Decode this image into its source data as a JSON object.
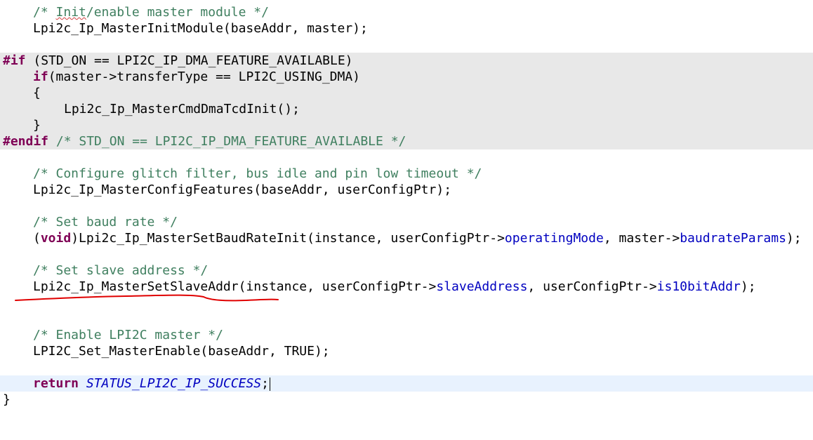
{
  "code": {
    "l1_comment_pre": "/* ",
    "l1_comment_word": "Init",
    "l1_comment_post": "/enable master module */",
    "l2": "Lpi2c_Ip_MasterInitModule(baseAddr, master);",
    "l4_directive": "#if",
    "l4_rest": " (STD_ON == LPI2C_IP_DMA_FEATURE_AVAILABLE)",
    "l5_kw": "if",
    "l5_rest": "(master->transferType == LPI2C_USING_DMA)",
    "l6": "{",
    "l7": "Lpi2c_Ip_MasterCmdDmaTcdInit();",
    "l8": "}",
    "l9_directive": "#endif",
    "l9_comment": " /* STD_ON == LPI2C_IP_DMA_FEATURE_AVAILABLE */",
    "l11_comment": "/* Configure glitch filter, bus idle and pin low timeout */",
    "l12": "Lpi2c_Ip_MasterConfigFeatures(baseAddr, userConfigPtr);",
    "l14_comment": "/* Set baud rate */",
    "l15_open": "(",
    "l15_kw": "void",
    "l15_a": ")Lpi2c_Ip_MasterSetBaudRateInit(instance, userConfigPtr->",
    "l15_field1": "operatingMode",
    "l15_b": ", master->",
    "l15_field2": "baudrateParams",
    "l15_c": ");",
    "l17_comment": "/* Set slave address */",
    "l18_a": "Lpi2c_Ip_MasterSetSlaveAddr(instance, userConfigPtr->",
    "l18_field1": "slaveAddress",
    "l18_b": ", userConfigPtr->",
    "l18_field2": "is10bitAddr",
    "l18_c": ");",
    "l21_comment": "/* Enable LPI2C master */",
    "l22": "LPI2C_Set_MasterEnable(baseAddr, TRUE);",
    "l24_kw": "return",
    "l24_enum": "STATUS_LPI2C_IP_SUCCESS",
    "l24_end": ";",
    "l25": "}"
  },
  "colors": {
    "comment": "#3f7f5f",
    "keyword": "#7f0055",
    "field": "#0000c0",
    "inactive_block": "#e8e8e8",
    "current_line": "#e8f2fe",
    "annotation": "#e00000"
  }
}
